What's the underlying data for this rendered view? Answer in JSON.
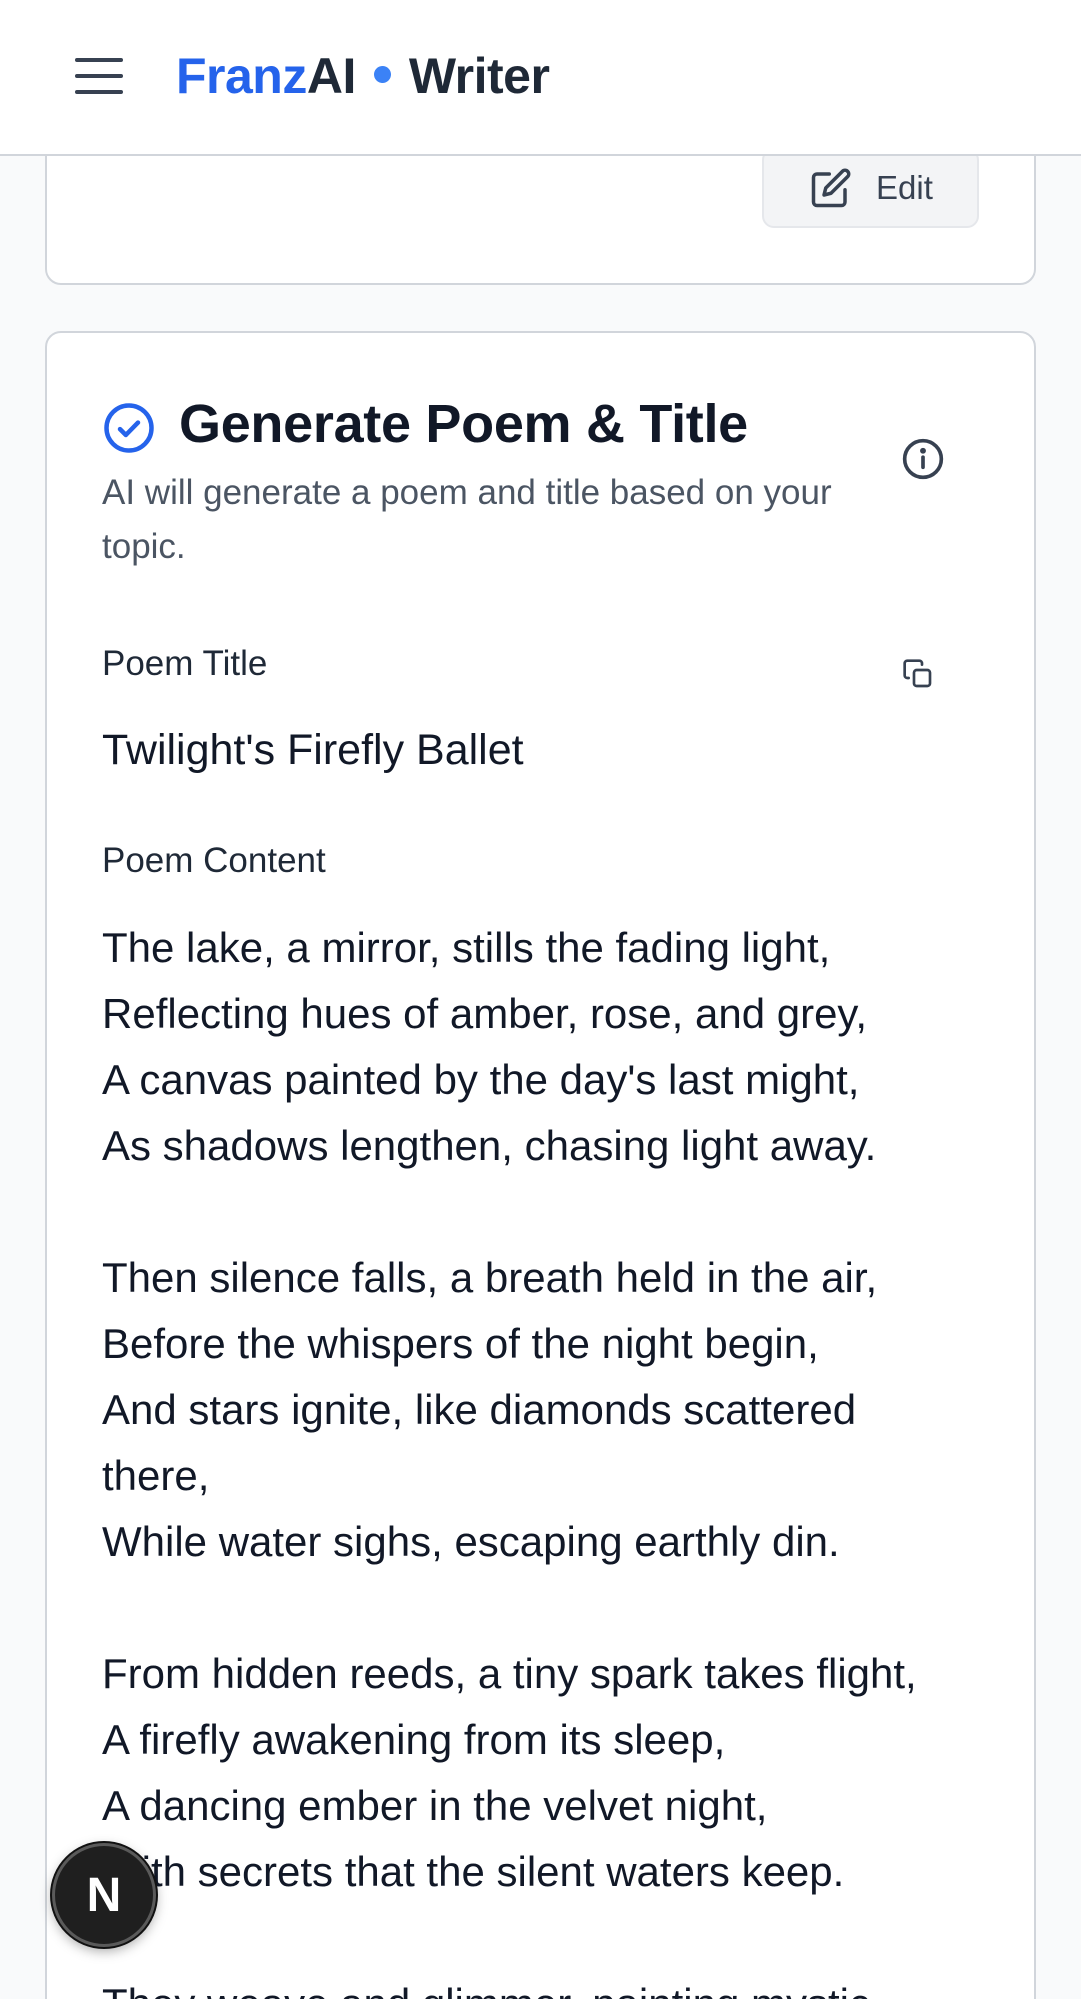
{
  "header": {
    "brand_part1": "Franz",
    "brand_part2": "AI",
    "brand_part3": "Writer",
    "accent_color": "#2563eb"
  },
  "previous_card": {
    "edit_label": "Edit"
  },
  "step": {
    "title": "Generate Poem & Title",
    "description": "AI will generate a poem and title based on your topic.",
    "status_icon": "check-circle-icon",
    "status_color": "#2563eb"
  },
  "fields": {
    "title_label": "Poem Title",
    "title_value": "Twilight's Firefly Ballet",
    "content_label": "Poem Content"
  },
  "poem": {
    "stanza1": [
      "The lake, a mirror, stills the fading light,",
      "Reflecting hues of amber, rose, and grey,",
      "A canvas painted by the day's last might,",
      "As shadows lengthen, chasing light away."
    ],
    "stanza2": [
      "Then silence falls, a breath held in the air,",
      "Before the whispers of the night begin,",
      "And stars ignite, like diamonds scattered there,",
      "While water sighs, escaping earthly din."
    ],
    "stanza3": [
      "From hidden reeds, a tiny spark takes flight,",
      "A firefly awakening from its sleep,",
      "A dancing ember in the velvet night,",
      "With secrets that the silent waters keep."
    ],
    "stanza4_partial": "They weave and glimmer, painting mystic"
  },
  "badge": {
    "letter": "N"
  }
}
